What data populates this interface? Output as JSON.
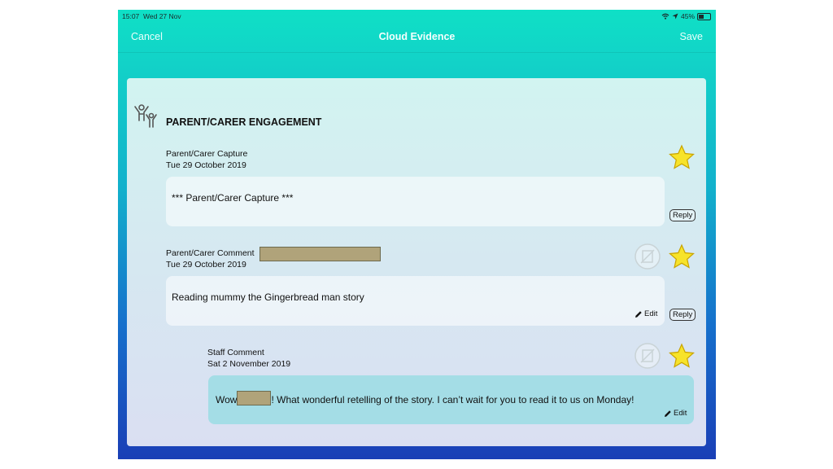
{
  "status_bar": {
    "time": "15:07",
    "date": "Wed 27 Nov",
    "battery": "45%",
    "battery_level": 0.45
  },
  "nav": {
    "cancel": "Cancel",
    "title": "Cloud Evidence",
    "save": "Save"
  },
  "section": {
    "title": "PARENT/CARER ENGAGEMENT",
    "icon": "parent-carer-icon"
  },
  "entries": [
    {
      "type": "Parent/Carer Capture",
      "date": "Tue 29 October 2019",
      "text": "*** Parent/Carer Capture ***",
      "reply": "Reply"
    },
    {
      "type": "Parent/Carer Comment",
      "date": "Tue 29 October 2019",
      "text": "Reading mummy the Gingerbread man story",
      "edit": "Edit",
      "reply": "Reply"
    }
  ],
  "staff_comment": {
    "type": "Staff Comment",
    "date": "Sat 2 November 2019",
    "text_before": "Wow",
    "text_after": "! What wonderful retelling of the story. I can’t wait for you to read it to us on Monday!",
    "edit": "Edit"
  },
  "colors": {
    "accent": "#0fe0c6",
    "star_fill": "#f7e32a",
    "star_stroke": "#c9a400",
    "redaction": "#b0a37a"
  }
}
